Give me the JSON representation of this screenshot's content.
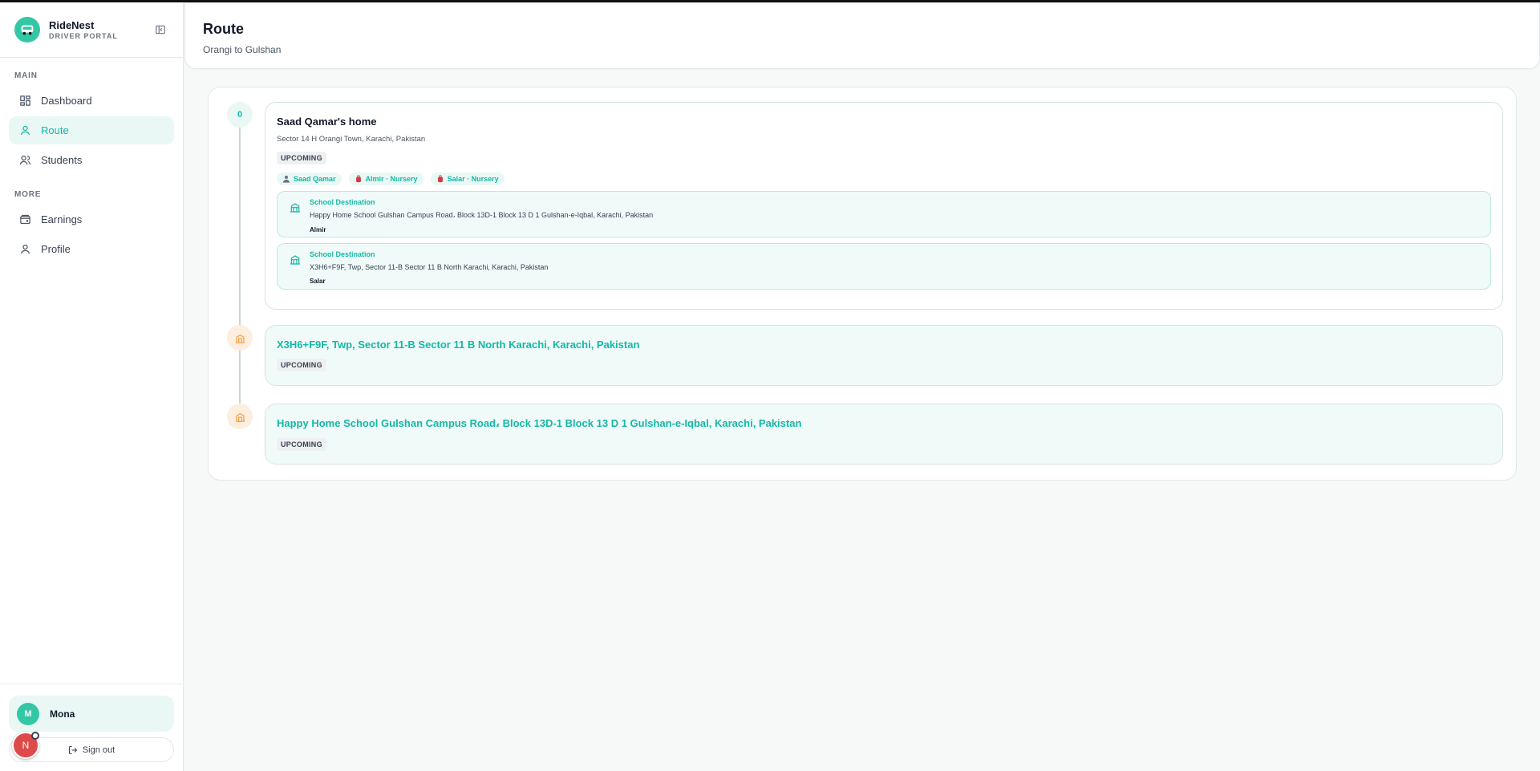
{
  "brand": {
    "name": "RideNest",
    "subtitle": "DRIVER PORTAL"
  },
  "nav": {
    "main_label": "MAIN",
    "more_label": "MORE",
    "items": [
      {
        "label": "Dashboard",
        "icon": "dashboard-icon"
      },
      {
        "label": "Route",
        "icon": "route-icon",
        "active": true
      },
      {
        "label": "Students",
        "icon": "students-icon"
      },
      {
        "label": "Earnings",
        "icon": "wallet-icon"
      },
      {
        "label": "Profile",
        "icon": "user-icon"
      }
    ]
  },
  "user": {
    "initial": "M",
    "name": "Mona",
    "signout_label": "Sign out",
    "dev_badge": "N"
  },
  "header": {
    "title": "Route",
    "subtitle": "Orangi to Gulshan"
  },
  "route": {
    "stops": [
      {
        "marker": "0",
        "title": "Saad Qamar's home",
        "address": "Sector 14 H Orangi Town, Karachi, Pakistan",
        "status": "UPCOMING",
        "tags": [
          "Saad Qamar",
          "Almir · Nursery",
          "Salar · Nursery"
        ],
        "destinations": [
          {
            "label": "School Destination",
            "address": "Happy Home School Gulshan Campus Road، Block 13D-1 Block 13 D 1 Gulshan-e-Iqbal, Karachi, Pakistan",
            "student": "Almir"
          },
          {
            "label": "School Destination",
            "address": "X3H6+F9F, Twp, Sector 11-B Sector 11 B North Karachi, Karachi, Pakistan",
            "student": "Salar"
          }
        ]
      },
      {
        "title": "X3H6+F9F, Twp, Sector 11-B Sector 11 B North Karachi, Karachi, Pakistan",
        "status": "UPCOMING"
      },
      {
        "title": "Happy Home School Gulshan Campus Road، Block 13D-1 Block 13 D 1 Gulshan-e-Iqbal, Karachi, Pakistan",
        "status": "UPCOMING"
      }
    ]
  },
  "colors": {
    "accent": "#14b8a6",
    "accent_bg": "#e9f8f5",
    "school_marker_bg": "#fdeee0",
    "school_marker_icon": "#f4a340"
  }
}
